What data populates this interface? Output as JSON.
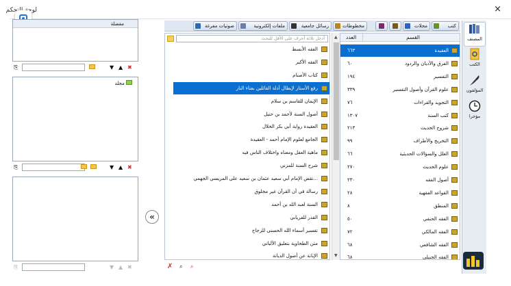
{
  "window": {
    "title": "لوحة التحكم",
    "close_label": "×"
  },
  "left_panel": {
    "favorites_header": "مفضلة",
    "tree_item": "مجلد"
  },
  "toolbar": {
    "tabs": [
      {
        "label": "كتب",
        "color": "#6a8f2f"
      },
      {
        "label": "مجلات",
        "color": "#2d63b8"
      },
      {
        "label": "",
        "color": "#7a5a18"
      },
      {
        "label": "",
        "color": "#7a2b6b"
      },
      {
        "label": "مخطوطات",
        "color": "#b8861c"
      },
      {
        "label": "رسائل جامعية",
        "color": "#333333"
      },
      {
        "label": "ملفات إلكترونية",
        "color": "#6c7ea1"
      },
      {
        "label": "صوتيات مفرغة",
        "color": "#2b6cb0"
      }
    ]
  },
  "books": {
    "search_placeholder": "أدخل ثلاثة أحرف على الأقل للبحث",
    "items": [
      "الفقه الأبسط",
      "الفقه الأكبر",
      "كتاب الأصنام",
      "رفع الأستار لإبطال أدلة القائلين بفناء النار",
      "الإيمان للقاسم بن سلام",
      "أصول السنة لأحمد بن حنبل",
      "العقيدة رواية أبي بكر الخلال",
      "الجامع لعلوم الإمام أحمد - العقيدة",
      "ماهية العقل ومعناه واختلاف الناس فيه",
      "شرح السنة للمزني",
      "نقض الإمام أبي سعيد عثمان بن سعيد على المريسي الجهمي...",
      "رسالة في أن القرآن غير مخلوق",
      "السنة لعبد الله بن أحمد",
      "القدر للفريابي",
      "تفسير أسماء الله الحسنى للزجاج",
      "متن الطحاوية بتعليق الألباني",
      "الإبانة عن أصول الديانة"
    ],
    "selected_index": 3
  },
  "categories": {
    "col_name": "القسم",
    "col_count": "العدد",
    "items": [
      {
        "name": "العقيدة",
        "count": "٦٦٣"
      },
      {
        "name": "الفرق والأديان والردود",
        "count": "٦٠"
      },
      {
        "name": "التفسير",
        "count": "١٩٤"
      },
      {
        "name": "علوم القرآن وأصول التفسير",
        "count": "٣٣٩"
      },
      {
        "name": "التجويد والقراءات",
        "count": "٧٦"
      },
      {
        "name": "كتب السنة",
        "count": "١٣٠٧"
      },
      {
        "name": "شروح الحديث",
        "count": "٢١٣"
      },
      {
        "name": "التخريج والأطراف",
        "count": "٩٩"
      },
      {
        "name": "العلل والسؤالات الحديثية",
        "count": "٦٦"
      },
      {
        "name": "علوم الحديث",
        "count": "٢٧٠"
      },
      {
        "name": "أصول الفقه",
        "count": "٢٣٠"
      },
      {
        "name": "القواعد الفقهية",
        "count": "٢٨"
      },
      {
        "name": "المنطق",
        "count": "٨"
      },
      {
        "name": "الفقه الحنفي",
        "count": "٥٠"
      },
      {
        "name": "الفقه المالكي",
        "count": "٧٢"
      },
      {
        "name": "الفقه الشافعي",
        "count": "٦٨"
      },
      {
        "name": "الفقه الحنبلي",
        "count": "٦٨"
      }
    ],
    "selected_index": 0
  },
  "sidebar": {
    "items": [
      {
        "label": "المصنف",
        "icon": "books-icon"
      },
      {
        "label": "الكتب",
        "icon": "book-search-icon"
      },
      {
        "label": "المؤلفون",
        "icon": "feather-icon"
      },
      {
        "label": "مؤخرا",
        "icon": "clock-icon"
      }
    ]
  }
}
